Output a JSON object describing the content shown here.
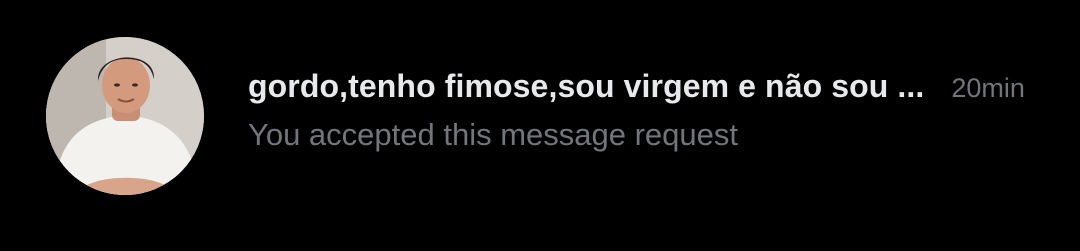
{
  "conversation": {
    "avatar_icon": "user-avatar-photo",
    "name": "gordo,tenho fimose,sou virgem e não sou ...",
    "time": "20min",
    "preview": "You accepted this message request"
  },
  "colors": {
    "background": "#000000",
    "name": "#e7e9ea",
    "secondary": "#71767b"
  }
}
